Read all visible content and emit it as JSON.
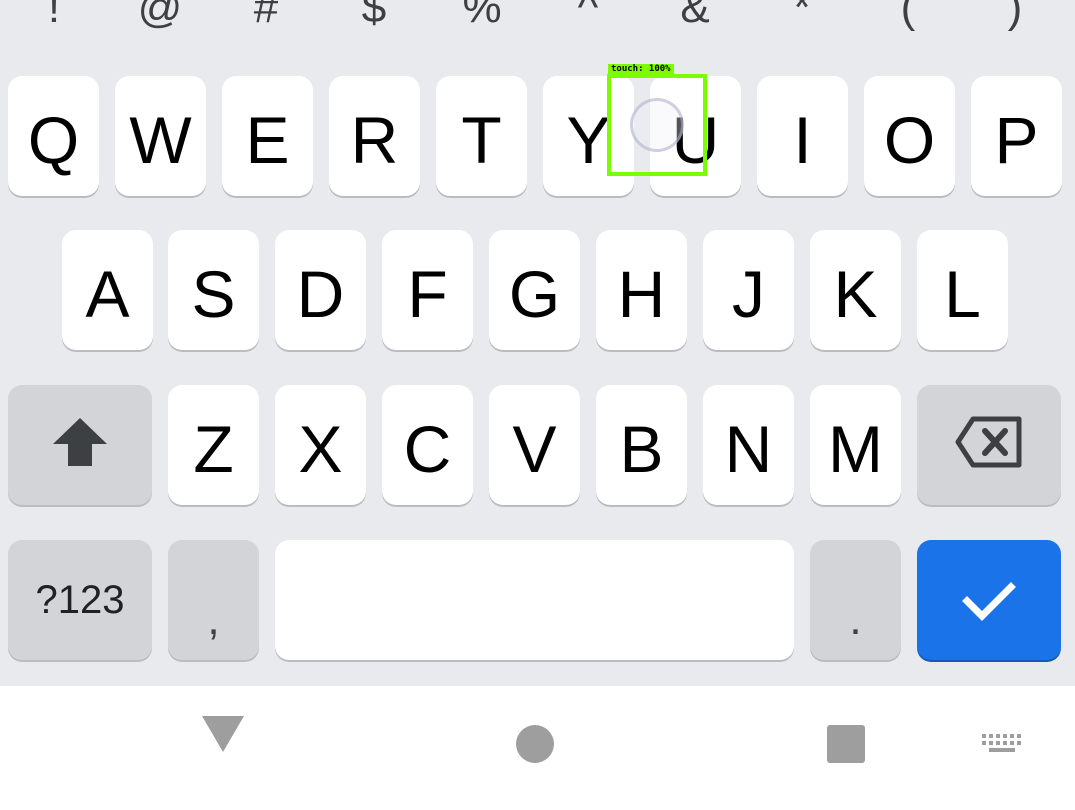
{
  "symbol_row": [
    "!",
    "@",
    "#",
    "$",
    "%",
    "^",
    "&",
    "*",
    "(",
    ")"
  ],
  "rows": {
    "row1": [
      "Q",
      "W",
      "E",
      "R",
      "T",
      "Y",
      "U",
      "I",
      "O",
      "P"
    ],
    "row2": [
      "A",
      "S",
      "D",
      "F",
      "G",
      "H",
      "J",
      "K",
      "L"
    ],
    "row3": [
      "Z",
      "X",
      "C",
      "V",
      "B",
      "N",
      "M"
    ]
  },
  "bottom_row": {
    "symbols_key": "?123",
    "comma_key": ",",
    "period_key": "."
  },
  "touch_overlay": {
    "label": "touch: 100%",
    "color": "#7cfc00"
  },
  "icons": {
    "shift": "shift-arrow-icon",
    "backspace": "backspace-icon",
    "enter": "checkmark-icon",
    "nav_back": "triangle-back-icon",
    "nav_home": "circle-home-icon",
    "nav_recents": "square-recents-icon",
    "nav_keyboard": "keyboard-switch-icon"
  },
  "colors": {
    "keyboard_bg": "#e8eaed",
    "key_bg": "#ffffff",
    "function_key_bg": "#d2d4d8",
    "enter_key_bg": "#1a73e8"
  }
}
